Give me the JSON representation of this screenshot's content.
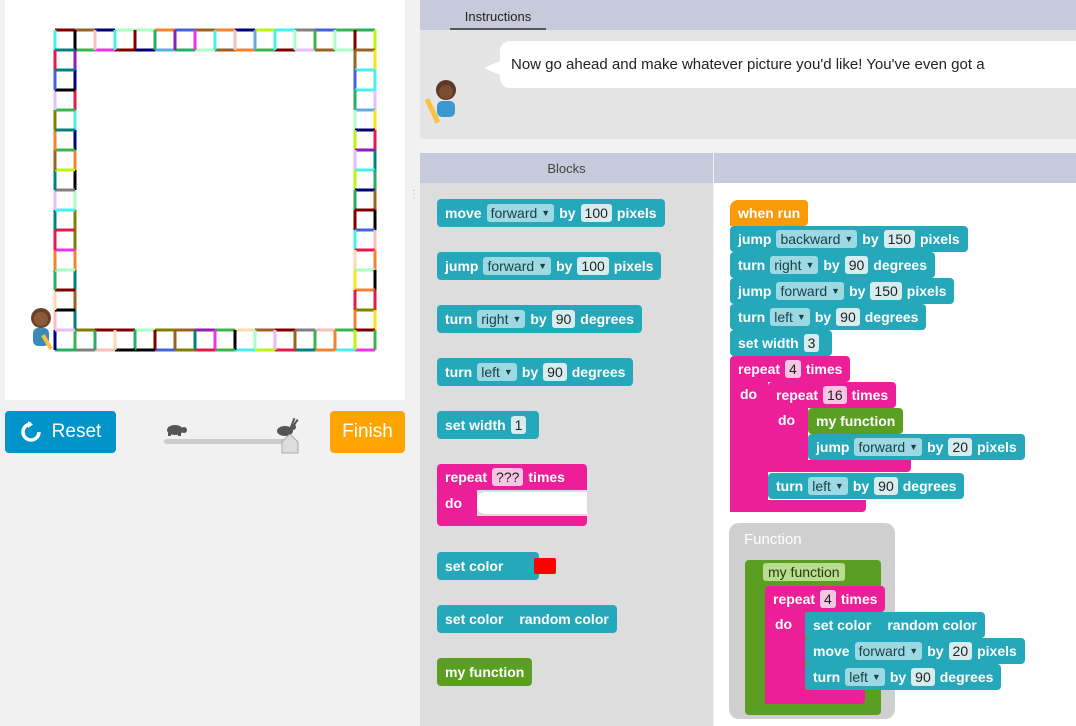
{
  "instructions": {
    "tab_label": "Instructions",
    "text": "Now go ahead and make whatever picture you'd like! You've even got a"
  },
  "controls": {
    "reset_label": "Reset",
    "finish_label": "Finish",
    "speed_slider_level": 1.0
  },
  "toolbox": {
    "header": "Blocks",
    "blocks": {
      "move": {
        "label1": "move",
        "dir": "forward",
        "label2": "by",
        "value": "100",
        "label3": "pixels"
      },
      "jump": {
        "label1": "jump",
        "dir": "forward",
        "label2": "by",
        "value": "100",
        "label3": "pixels"
      },
      "turn_right": {
        "label1": "turn",
        "dir": "right",
        "label2": "by",
        "value": "90",
        "label3": "degrees"
      },
      "turn_left": {
        "label1": "turn",
        "dir": "left",
        "label2": "by",
        "value": "90",
        "label3": "degrees"
      },
      "set_width": {
        "label": "set width",
        "value": "1"
      },
      "repeat": {
        "label1": "repeat",
        "value": "???",
        "label2": "times",
        "do": "do"
      },
      "set_color": {
        "label": "set color",
        "color": "#ff0000"
      },
      "set_random_color": {
        "label": "set color",
        "value": "random color"
      },
      "my_function": {
        "label": "my function"
      }
    }
  },
  "workspace": {
    "when_run": "when run",
    "main": {
      "jump1": {
        "label1": "jump",
        "dir": "backward",
        "label2": "by",
        "value": "150",
        "label3": "pixels"
      },
      "turn1": {
        "label1": "turn",
        "dir": "right",
        "label2": "by",
        "value": "90",
        "label3": "degrees"
      },
      "jump2": {
        "label1": "jump",
        "dir": "forward",
        "label2": "by",
        "value": "150",
        "label3": "pixels"
      },
      "turn2": {
        "label1": "turn",
        "dir": "left",
        "label2": "by",
        "value": "90",
        "label3": "degrees"
      },
      "set_width": {
        "label": "set width",
        "value": "3"
      },
      "repeat_outer": {
        "label1": "repeat",
        "value": "4",
        "label2": "times",
        "do": "do"
      },
      "repeat_inner": {
        "label1": "repeat",
        "value": "16",
        "label2": "times",
        "do": "do"
      },
      "call_fn": {
        "label": "my function"
      },
      "jump3": {
        "label1": "jump",
        "dir": "forward",
        "label2": "by",
        "value": "20",
        "label3": "pixels"
      },
      "turn3": {
        "label1": "turn",
        "dir": "left",
        "label2": "by",
        "value": "90",
        "label3": "degrees"
      }
    },
    "function_def": {
      "frame_label": "Function",
      "name": "my function",
      "repeat": {
        "label1": "repeat",
        "value": "4",
        "label2": "times",
        "do": "do"
      },
      "set_color": {
        "label": "set color",
        "value": "random color"
      },
      "move": {
        "label1": "move",
        "dir": "forward",
        "label2": "by",
        "value": "20",
        "label3": "pixels"
      },
      "turn": {
        "label1": "turn",
        "dir": "left",
        "label2": "by",
        "value": "90",
        "label3": "degrees"
      }
    }
  },
  "colors": {
    "teal": "#26a8bb",
    "pink": "#ec1f99",
    "orange": "#f99b09",
    "green": "#5a9f21",
    "reset": "#0094ca",
    "finish": "#ffa400"
  }
}
